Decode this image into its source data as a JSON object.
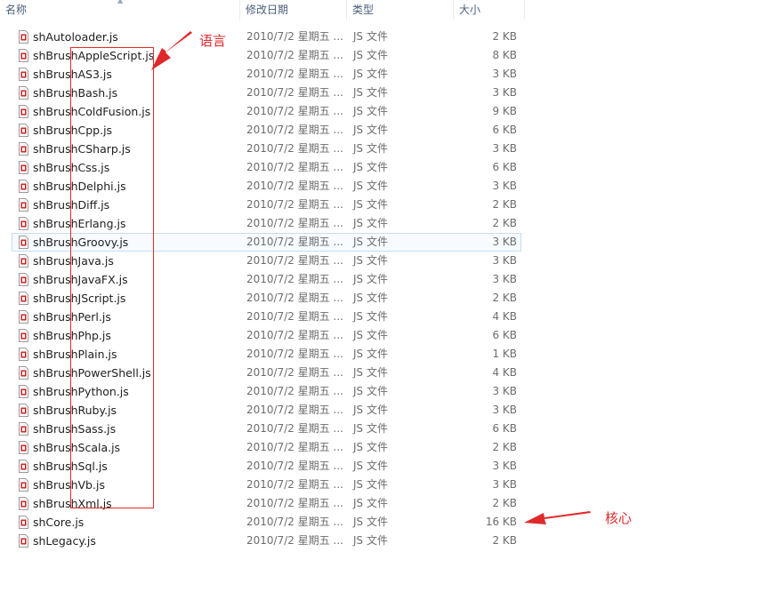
{
  "columns": {
    "name": "名称",
    "date": "修改日期",
    "type": "类型",
    "size": "大小"
  },
  "files": [
    {
      "name": "shAutoloader.js",
      "date": "2010/7/2 星期五 ...",
      "type": "JS 文件",
      "size": "2 KB"
    },
    {
      "name": "shBrushAppleScript.js",
      "date": "2010/7/2 星期五 ...",
      "type": "JS 文件",
      "size": "8 KB"
    },
    {
      "name": "shBrushAS3.js",
      "date": "2010/7/2 星期五 ...",
      "type": "JS 文件",
      "size": "3 KB"
    },
    {
      "name": "shBrushBash.js",
      "date": "2010/7/2 星期五 ...",
      "type": "JS 文件",
      "size": "3 KB"
    },
    {
      "name": "shBrushColdFusion.js",
      "date": "2010/7/2 星期五 ...",
      "type": "JS 文件",
      "size": "9 KB"
    },
    {
      "name": "shBrushCpp.js",
      "date": "2010/7/2 星期五 ...",
      "type": "JS 文件",
      "size": "6 KB"
    },
    {
      "name": "shBrushCSharp.js",
      "date": "2010/7/2 星期五 ...",
      "type": "JS 文件",
      "size": "3 KB"
    },
    {
      "name": "shBrushCss.js",
      "date": "2010/7/2 星期五 ...",
      "type": "JS 文件",
      "size": "6 KB"
    },
    {
      "name": "shBrushDelphi.js",
      "date": "2010/7/2 星期五 ...",
      "type": "JS 文件",
      "size": "3 KB"
    },
    {
      "name": "shBrushDiff.js",
      "date": "2010/7/2 星期五 ...",
      "type": "JS 文件",
      "size": "2 KB"
    },
    {
      "name": "shBrushErlang.js",
      "date": "2010/7/2 星期五 ...",
      "type": "JS 文件",
      "size": "2 KB"
    },
    {
      "name": "shBrushGroovy.js",
      "date": "2010/7/2 星期五 ...",
      "type": "JS 文件",
      "size": "3 KB"
    },
    {
      "name": "shBrushJava.js",
      "date": "2010/7/2 星期五 ...",
      "type": "JS 文件",
      "size": "3 KB"
    },
    {
      "name": "shBrushJavaFX.js",
      "date": "2010/7/2 星期五 ...",
      "type": "JS 文件",
      "size": "3 KB"
    },
    {
      "name": "shBrushJScript.js",
      "date": "2010/7/2 星期五 ...",
      "type": "JS 文件",
      "size": "2 KB"
    },
    {
      "name": "shBrushPerl.js",
      "date": "2010/7/2 星期五 ...",
      "type": "JS 文件",
      "size": "4 KB"
    },
    {
      "name": "shBrushPhp.js",
      "date": "2010/7/2 星期五 ...",
      "type": "JS 文件",
      "size": "6 KB"
    },
    {
      "name": "shBrushPlain.js",
      "date": "2010/7/2 星期五 ...",
      "type": "JS 文件",
      "size": "1 KB"
    },
    {
      "name": "shBrushPowerShell.js",
      "date": "2010/7/2 星期五 ...",
      "type": "JS 文件",
      "size": "4 KB"
    },
    {
      "name": "shBrushPython.js",
      "date": "2010/7/2 星期五 ...",
      "type": "JS 文件",
      "size": "3 KB"
    },
    {
      "name": "shBrushRuby.js",
      "date": "2010/7/2 星期五 ...",
      "type": "JS 文件",
      "size": "3 KB"
    },
    {
      "name": "shBrushSass.js",
      "date": "2010/7/2 星期五 ...",
      "type": "JS 文件",
      "size": "6 KB"
    },
    {
      "name": "shBrushScala.js",
      "date": "2010/7/2 星期五 ...",
      "type": "JS 文件",
      "size": "2 KB"
    },
    {
      "name": "shBrushSql.js",
      "date": "2010/7/2 星期五 ...",
      "type": "JS 文件",
      "size": "3 KB"
    },
    {
      "name": "shBrushVb.js",
      "date": "2010/7/2 星期五 ...",
      "type": "JS 文件",
      "size": "3 KB"
    },
    {
      "name": "shBrushXml.js",
      "date": "2010/7/2 星期五 ...",
      "type": "JS 文件",
      "size": "2 KB"
    },
    {
      "name": "shCore.js",
      "date": "2010/7/2 星期五 ...",
      "type": "JS 文件",
      "size": "16 KB"
    },
    {
      "name": "shLegacy.js",
      "date": "2010/7/2 星期五 ...",
      "type": "JS 文件",
      "size": "2 KB"
    }
  ],
  "selected_file": "shBrushGroovy.js",
  "annotations": {
    "languages": "语言",
    "core": "核心"
  },
  "colors": {
    "annotation": "#e0292b",
    "selection_border": "#c7dcf5",
    "header_text": "#4c607a",
    "icon": "#cc2222"
  },
  "file_icon": "js-file-icon"
}
